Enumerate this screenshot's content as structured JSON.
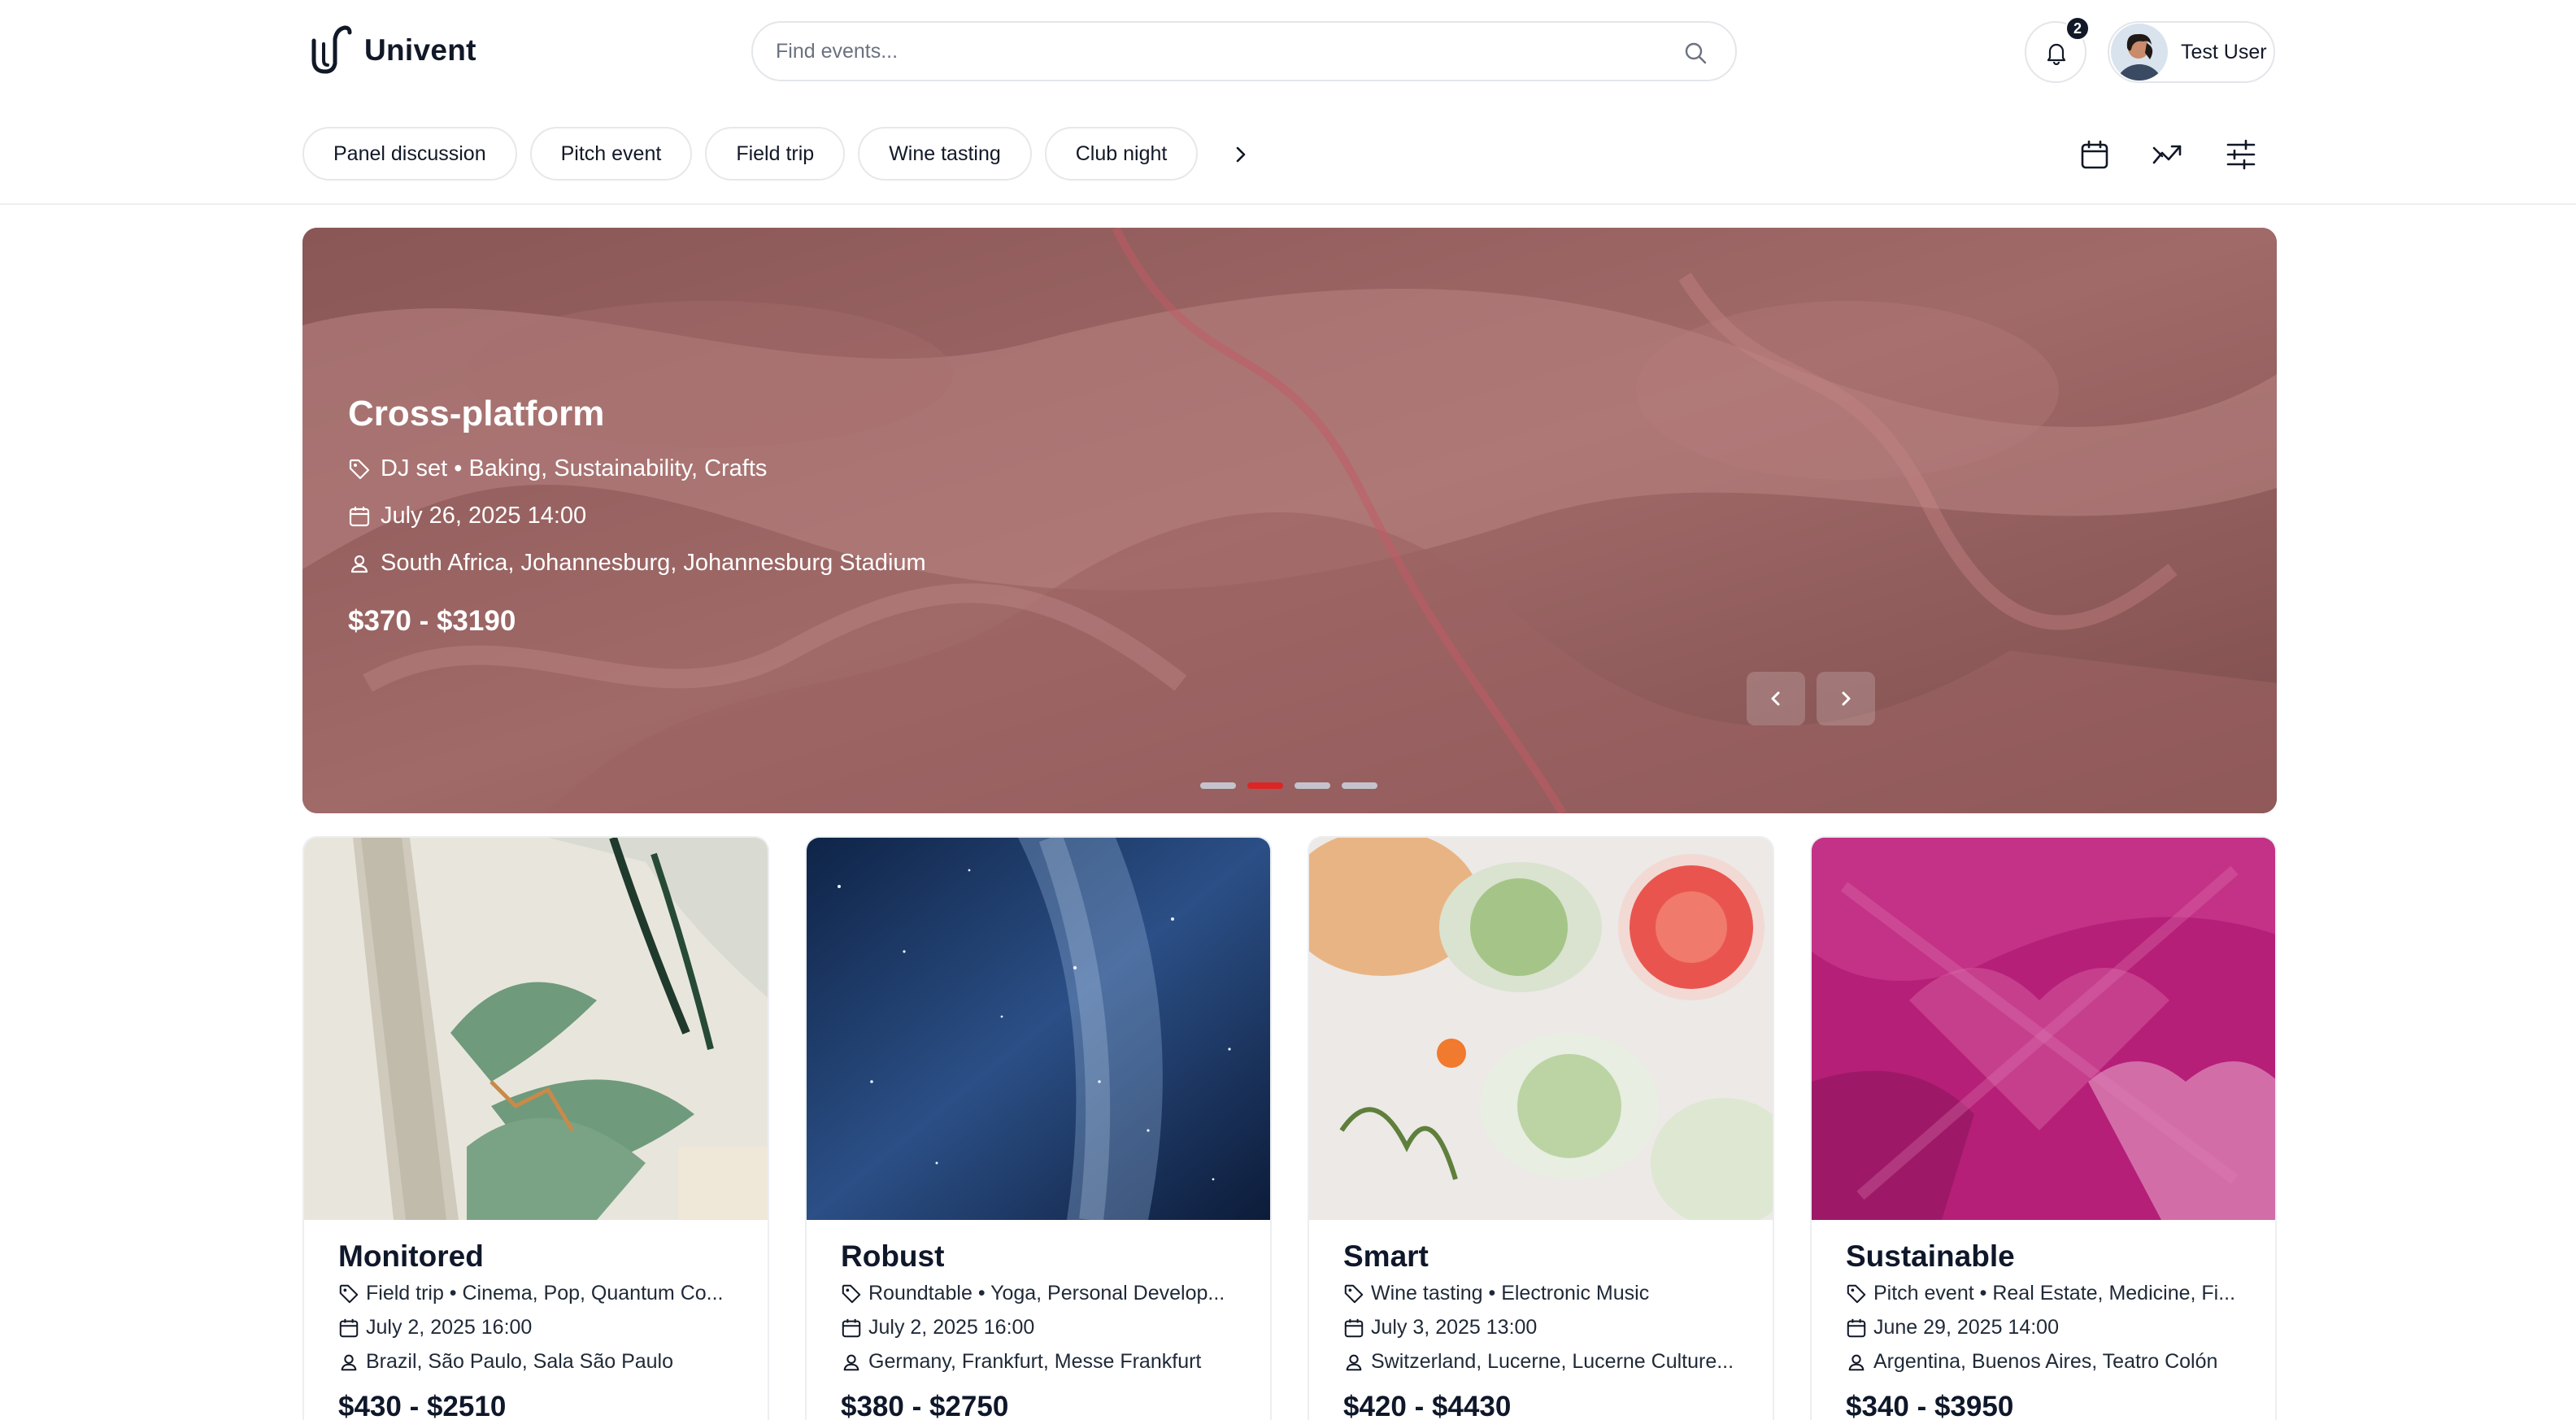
{
  "app": {
    "name": "Univent"
  },
  "search": {
    "placeholder": "Find events..."
  },
  "notifications": {
    "count": "2"
  },
  "user": {
    "name": "Test User"
  },
  "categories": [
    "Panel discussion",
    "Pitch event",
    "Field trip",
    "Wine tasting",
    "Club night"
  ],
  "icons": {
    "categories_next": "chevron-right-icon",
    "calendar": "calendar-icon",
    "trending": "trending-icon",
    "filters": "sliders-icon",
    "tag": "tag-icon",
    "date": "calendar-icon",
    "location": "map-pin-user-icon"
  },
  "hero": {
    "title": "Cross-platform",
    "tags": "DJ set • Baking, Sustainability, Crafts",
    "date": "July 26, 2025 14:00",
    "location": "South Africa, Johannesburg, Johannesburg Stadium",
    "price": "$370 - $3190",
    "slides": 4,
    "active_slide": 2
  },
  "events": [
    {
      "title": "Monitored",
      "tags": "Field trip • Cinema, Pop, Quantum Co...",
      "date": "July 2, 2025 16:00",
      "location": "Brazil, São Paulo, Sala São Paulo",
      "price": "$430 - $2510"
    },
    {
      "title": "Robust",
      "tags": "Roundtable • Yoga, Personal Develop...",
      "date": "July 2, 2025 16:00",
      "location": "Germany, Frankfurt, Messe Frankfurt",
      "price": "$380 - $2750"
    },
    {
      "title": "Smart",
      "tags": "Wine tasting • Electronic Music",
      "date": "July 3, 2025 13:00",
      "location": "Switzerland, Lucerne, Lucerne Culture...",
      "price": "$420 - $4430"
    },
    {
      "title": "Sustainable",
      "tags": "Pitch event • Real Estate, Medicine, Fi...",
      "date": "June 29, 2025 14:00",
      "location": "Argentina, Buenos Aires, Teatro Colón",
      "price": "$340 - $3950"
    }
  ],
  "colors": {
    "accent": "#dc2626",
    "hero_overlay": "#8c5a5a",
    "text": "#0f172a",
    "border": "#eceef1"
  }
}
